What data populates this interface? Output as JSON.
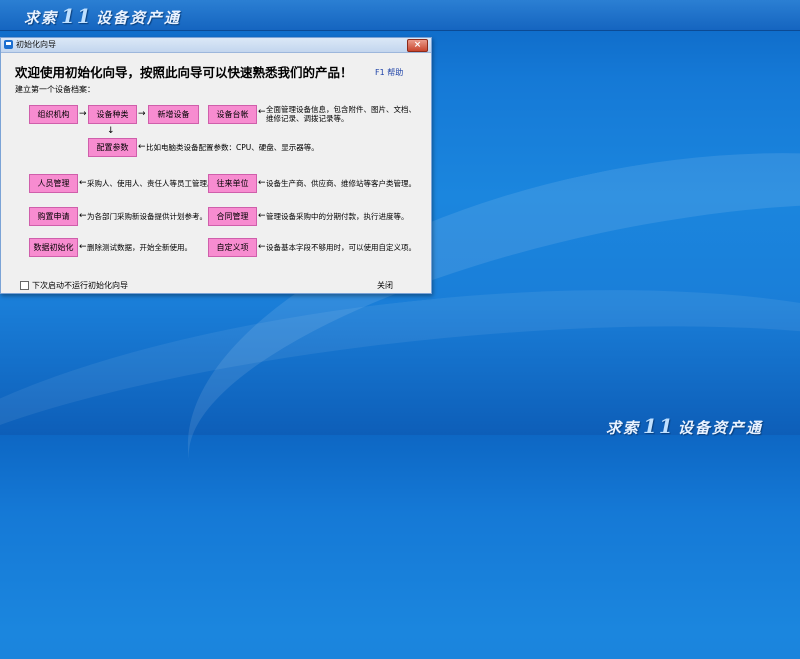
{
  "desktop": {
    "brand_a": "求索",
    "brand_b": "11",
    "brand_c": "设备资产通"
  },
  "dialog": {
    "title": "初始化向导",
    "close_glyph": "×",
    "welcome": "欢迎使用初始化向导，按照此向导可以快速熟悉我们的产品！",
    "help": "F1 帮助",
    "subtitle": "建立第一个设备档案：",
    "nodes": {
      "org": "组织机构",
      "category": "设备种类",
      "add_device": "新增设备",
      "ledger": "设备台帐",
      "config": "配置参数",
      "personnel": "人员管理",
      "contacts": "往来单位",
      "purchase": "购置申请",
      "contract": "合同管理",
      "data_init": "数据初始化",
      "custom": "自定义项"
    },
    "arrows": {
      "right": "→",
      "down": "↓",
      "left": "←"
    },
    "descs": {
      "ledger_1": "全面管理设备信息，包含附件、图片、文档、",
      "ledger_2": "维修记录、调拨记录等。",
      "config": "比如电脑类设备配置参数：CPU、硬盘、显示器等。",
      "personnel": "采购人、使用人、责任人等员工管理。",
      "contacts": "设备生产商、供应商、维修站等客户类管理。",
      "purchase": "为各部门采购新设备提供计划参考。",
      "contract": "管理设备采购中的分期付款，执行进度等。",
      "data_init": "删除测试数据，开始全新使用。",
      "custom": "设备基本字段不够用时，可以使用自定义项。"
    },
    "checkbox_label": "下次启动不运行初始化向导",
    "close_label": "关闭"
  }
}
